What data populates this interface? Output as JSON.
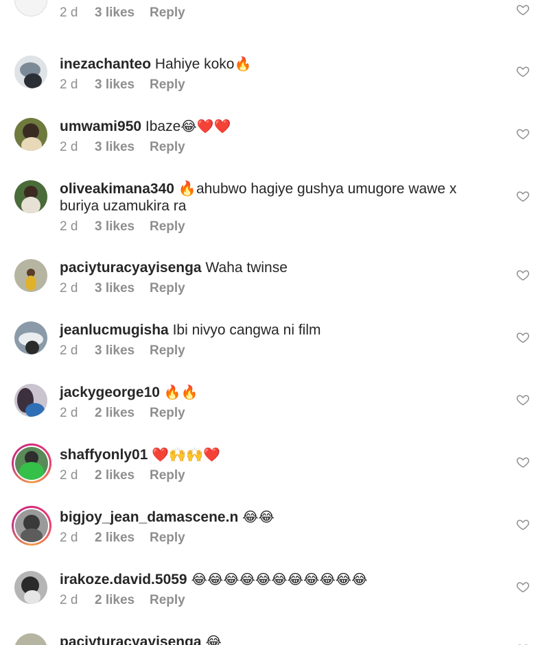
{
  "comments": [
    {
      "username": "",
      "text": "",
      "emoji": "😂",
      "time": "2 d",
      "likes": "3 likes",
      "reply": "Reply"
    },
    {
      "username": "inezachanteo",
      "text": "Hahiye koko",
      "emoji": "🔥",
      "time": "2 d",
      "likes": "3 likes",
      "reply": "Reply"
    },
    {
      "username": "umwami950",
      "text": "Ibaze",
      "emoji": "😂❤️❤️",
      "time": "2 d",
      "likes": "3 likes",
      "reply": "Reply"
    },
    {
      "username": "oliveakimana340",
      "text": "🔥ahubwo hagiye gushya umugore wawe x buriya uzamukira ra",
      "emoji": "",
      "time": "2 d",
      "likes": "3 likes",
      "reply": "Reply"
    },
    {
      "username": "paciyturacyayisenga",
      "text": "Waha twinse",
      "emoji": "",
      "time": "2 d",
      "likes": "3 likes",
      "reply": "Reply"
    },
    {
      "username": "jeanlucmugisha",
      "text": "Ibi nivyo cangwa ni film",
      "emoji": "",
      "time": "2 d",
      "likes": "3 likes",
      "reply": "Reply"
    },
    {
      "username": "jackygeorge10",
      "text": "",
      "emoji": "🔥🔥",
      "time": "2 d",
      "likes": "2 likes",
      "reply": "Reply"
    },
    {
      "username": "shaffyonly01",
      "text": "",
      "emoji": "❤️🙌🙌❤️",
      "time": "2 d",
      "likes": "2 likes",
      "reply": "Reply"
    },
    {
      "username": "bigjoy_jean_damascene.n",
      "text": "",
      "emoji": "😂😂",
      "time": "2 d",
      "likes": "2 likes",
      "reply": "Reply"
    },
    {
      "username": "irakoze.david.5059",
      "text": "",
      "emoji": "😂😂😂😂😂😂😂😂😂😂😂",
      "time": "2 d",
      "likes": "2 likes",
      "reply": "Reply"
    },
    {
      "username": "paciyturacyayisenga",
      "text": "",
      "emoji": "😂",
      "time": "",
      "likes": "",
      "reply": ""
    }
  ],
  "icons": {
    "like": "heart-outline-icon"
  },
  "colors": {
    "text": "#262626",
    "meta": "#8e8e8e",
    "story_ring": "#d72a7a"
  }
}
